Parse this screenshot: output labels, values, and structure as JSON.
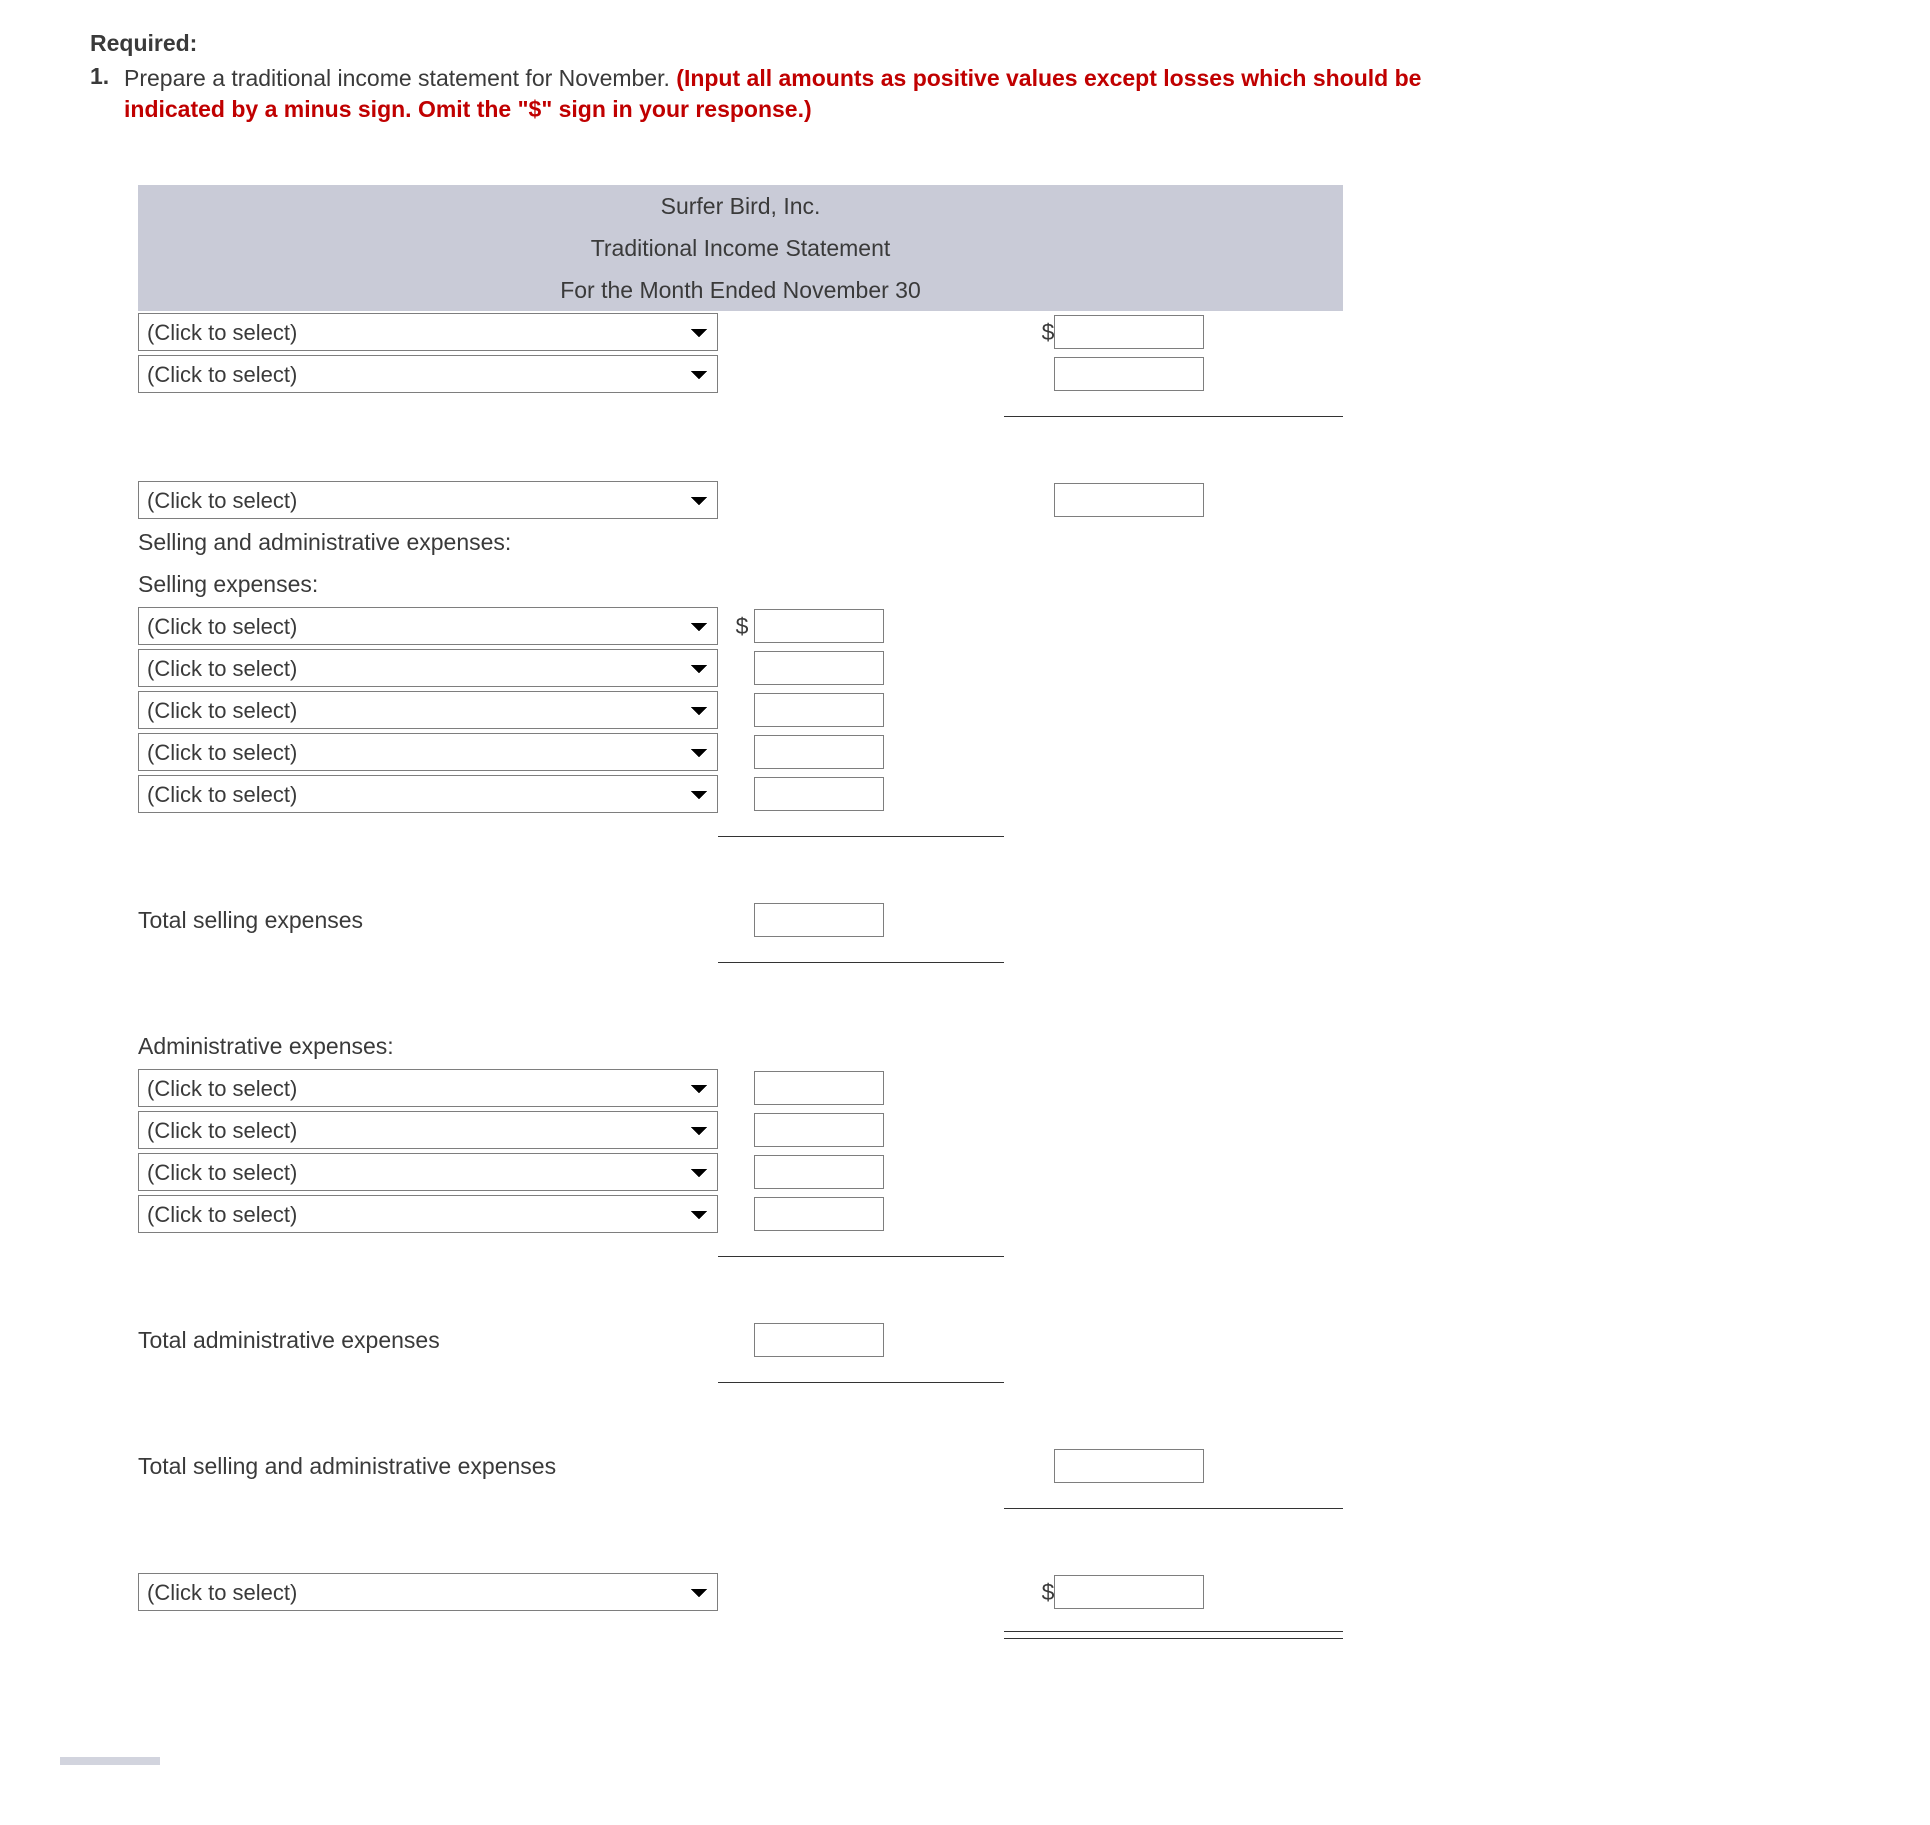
{
  "required": {
    "heading": "Required:",
    "item_number": "1.",
    "instruction_prefix": "Prepare a traditional income statement for November. ",
    "instruction_red": "(Input all amounts as positive values except losses which should be indicated by a minus sign. Omit the \"$\" sign in your response.)"
  },
  "statement": {
    "company": "Surfer Bird, Inc.",
    "title": "Traditional Income Statement",
    "period": "For the Month Ended November 30",
    "select_placeholder": "(Click to select)",
    "dollar": "$",
    "labels": {
      "sga_heading": "Selling and administrative expenses:",
      "selling_heading": "Selling expenses:",
      "total_selling": "Total selling expenses",
      "admin_heading": "Administrative expenses:",
      "total_admin": "Total administrative expenses",
      "total_sga": "Total selling and administrative expenses"
    }
  }
}
